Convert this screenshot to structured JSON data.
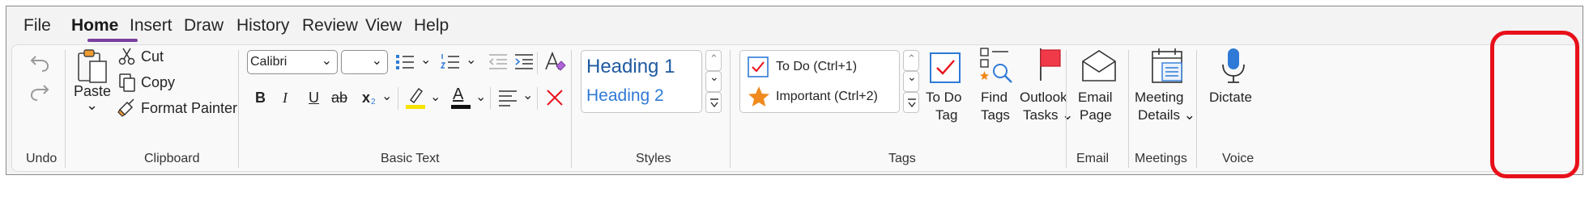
{
  "menu": {
    "tabs": [
      "File",
      "Home",
      "Insert",
      "Draw",
      "History",
      "Review",
      "View",
      "Help"
    ],
    "active": "Home"
  },
  "groups": {
    "undo": "Undo",
    "clipboard": "Clipboard",
    "basic_text": "Basic Text",
    "styles": "Styles",
    "tags": "Tags",
    "email": "Email",
    "meetings": "Meetings",
    "voice": "Voice"
  },
  "clipboard": {
    "paste": "Paste",
    "paste_arrow": "⌄",
    "cut": "Cut",
    "copy": "Copy",
    "format_painter": "Format Painter"
  },
  "basic_text": {
    "font_name": "Calibri",
    "font_size": "",
    "bold": "B",
    "italic": "I",
    "underline": "U",
    "strikethrough": "ab",
    "subscript": "x",
    "subscript_small": "2",
    "font_color": "A"
  },
  "styles": {
    "heading1": "Heading 1",
    "heading2": "Heading 2"
  },
  "tags": {
    "todo": "To Do (Ctrl+1)",
    "important": "Important (Ctrl+2)",
    "todo_tag_line1": "To Do",
    "todo_tag_line2": "Tag",
    "find_tags_line1": "Find",
    "find_tags_line2": "Tags",
    "outlook_line1": "Outlook",
    "outlook_line2": "Tasks ⌄"
  },
  "email": {
    "line1": "Email",
    "line2": "Page"
  },
  "meetings": {
    "line1": "Meeting",
    "line2": "Details ⌄"
  },
  "voice": {
    "dictate": "Dictate"
  },
  "colors": {
    "accent_purple": "#7a3fa0",
    "heading_blue": "#1f5aa0",
    "highlight_yellow": "#f5e400",
    "tag_red": "#e8101a",
    "star_orange": "#f08a1e",
    "icon_blue": "#2f7ad6"
  }
}
